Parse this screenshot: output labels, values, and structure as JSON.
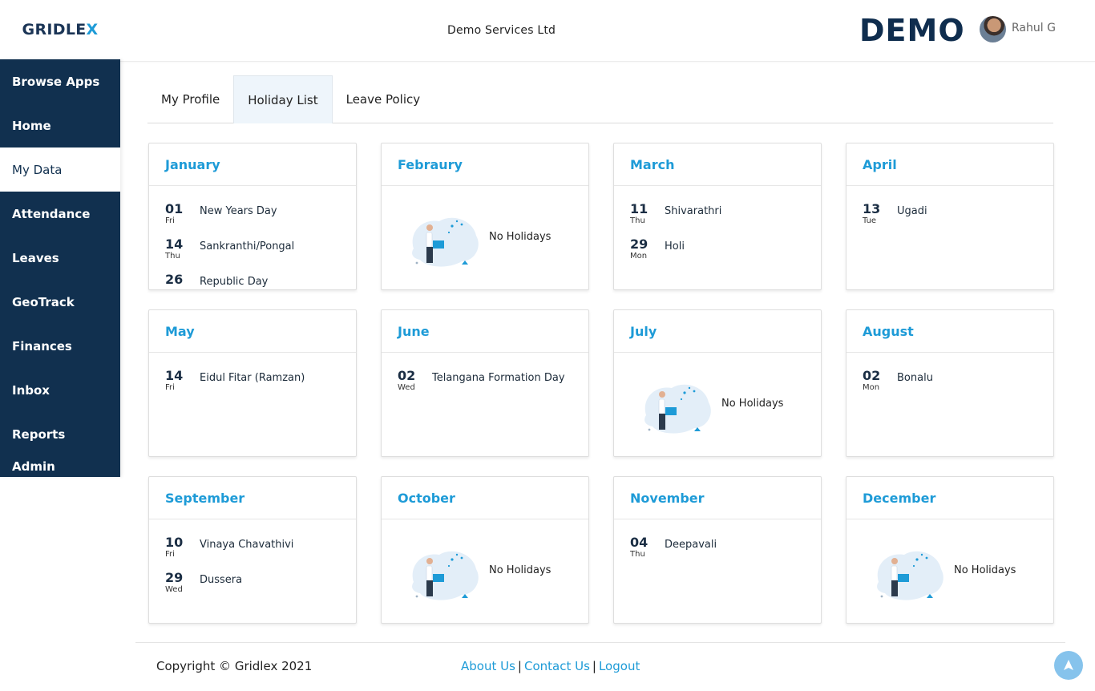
{
  "sidebar": {
    "logo_main": "GRIDLE",
    "logo_x": "X",
    "items": [
      {
        "label": "Browse Apps"
      },
      {
        "label": "Home"
      },
      {
        "label": "My Data"
      },
      {
        "label": "Attendance"
      },
      {
        "label": "Leaves"
      },
      {
        "label": "GeoTrack"
      },
      {
        "label": "Finances"
      },
      {
        "label": "Inbox"
      },
      {
        "label": "Reports"
      },
      {
        "label": "Admin"
      }
    ],
    "active_item": "My Data"
  },
  "header": {
    "company": "Demo Services Ltd",
    "brand": "DEMO",
    "user_name": "Rahul G"
  },
  "tabs": [
    {
      "label": "My Profile"
    },
    {
      "label": "Holiday List"
    },
    {
      "label": "Leave Policy"
    }
  ],
  "active_tab": "Holiday List",
  "empty_text": "No Holidays",
  "months": [
    {
      "name": "January",
      "holidays": [
        {
          "day": "01",
          "weekday": "Fri",
          "name": "New Years Day"
        },
        {
          "day": "14",
          "weekday": "Thu",
          "name": "Sankranthi/Pongal"
        },
        {
          "day": "26",
          "weekday": "",
          "name": "Republic Day"
        }
      ]
    },
    {
      "name": "Febraury",
      "holidays": []
    },
    {
      "name": "March",
      "holidays": [
        {
          "day": "11",
          "weekday": "Thu",
          "name": "Shivarathri"
        },
        {
          "day": "29",
          "weekday": "Mon",
          "name": "Holi"
        }
      ]
    },
    {
      "name": "April",
      "holidays": [
        {
          "day": "13",
          "weekday": "Tue",
          "name": "Ugadi"
        }
      ]
    },
    {
      "name": "May",
      "holidays": [
        {
          "day": "14",
          "weekday": "Fri",
          "name": "Eidul Fitar (Ramzan)"
        }
      ]
    },
    {
      "name": "June",
      "holidays": [
        {
          "day": "02",
          "weekday": "Wed",
          "name": "Telangana Formation Day"
        }
      ]
    },
    {
      "name": "July",
      "holidays": []
    },
    {
      "name": "August",
      "holidays": [
        {
          "day": "02",
          "weekday": "Mon",
          "name": "Bonalu"
        }
      ]
    },
    {
      "name": "September",
      "holidays": [
        {
          "day": "10",
          "weekday": "Fri",
          "name": "Vinaya Chavathivi"
        },
        {
          "day": "29",
          "weekday": "Wed",
          "name": "Dussera"
        }
      ]
    },
    {
      "name": "October",
      "holidays": []
    },
    {
      "name": "November",
      "holidays": [
        {
          "day": "04",
          "weekday": "Thu",
          "name": "Deepavali"
        }
      ]
    },
    {
      "name": "December",
      "holidays": []
    }
  ],
  "footer": {
    "copyright": "Copyright © Gridlex 2021",
    "about": "About Us",
    "contact": "Contact Us",
    "logout": "Logout",
    "separator": "|"
  },
  "colors": {
    "navy": "#11304f",
    "accent": "#1e9bd7"
  },
  "icons": {
    "scroll_top": "arrow-up-icon"
  }
}
